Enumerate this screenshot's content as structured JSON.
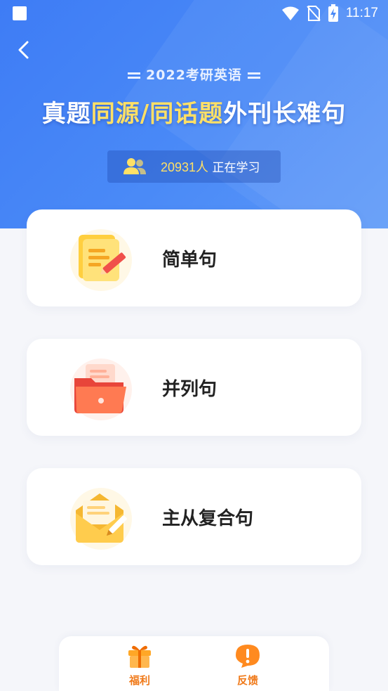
{
  "status_bar": {
    "time": "11:17"
  },
  "header": {
    "subtitle": "2022考研英语",
    "headline_part1": "真题",
    "headline_highlight": "同源/同话题",
    "headline_part2": "外刊长难句",
    "learner_count": "20931人",
    "learner_suffix": " 正在学习"
  },
  "categories": [
    {
      "label": "简单句",
      "icon": "scroll-pencil-icon"
    },
    {
      "label": "并列句",
      "icon": "folder-icon"
    },
    {
      "label": "主从复合句",
      "icon": "envelope-pen-icon"
    }
  ],
  "bottom_tabs": [
    {
      "label": "福利",
      "icon": "gift-icon"
    },
    {
      "label": "反馈",
      "icon": "feedback-alert-icon"
    }
  ],
  "colors": {
    "accent_blue": "#3e7cf5",
    "highlight_yellow": "#ffe066",
    "tab_orange": "#f07a1a"
  }
}
